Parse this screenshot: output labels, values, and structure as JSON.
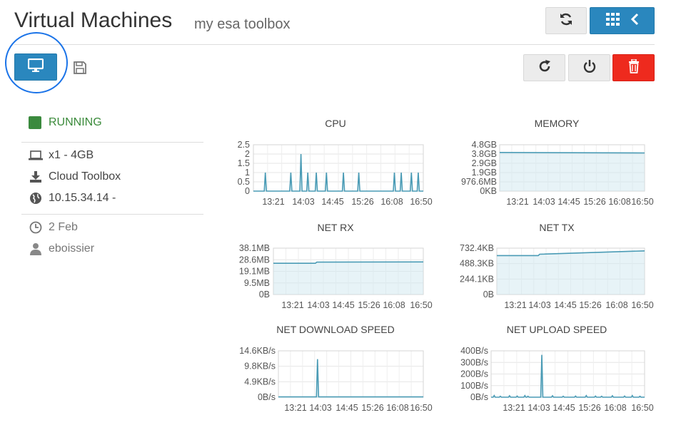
{
  "header": {
    "title": "Virtual Machines",
    "subtitle": "my esa toolbox"
  },
  "icons": {
    "refresh": "refresh-icon",
    "apps": "grid-icon",
    "back": "chevron-left-icon",
    "console": "monitor-icon",
    "snapshot": "floppy-disk-icon",
    "restart": "restart-icon",
    "power": "power-icon",
    "delete": "trash-icon"
  },
  "colors": {
    "accent": "#2a87be",
    "danger": "#ee2a1e",
    "running": "#3b8a3e",
    "line": "#4a9bb5"
  },
  "vm": {
    "status": "RUNNING",
    "specs": "x1 - 4GB",
    "image": "Cloud Toolbox",
    "ip": "10.15.34.14 -",
    "created": "2 Feb",
    "owner": "eboissier"
  },
  "chart_data": [
    {
      "id": "cpu",
      "type": "line",
      "title": "CPU",
      "x": [
        "13:21",
        "14:03",
        "14:45",
        "15:26",
        "16:08",
        "16:50"
      ],
      "y_ticks": [
        "2.5",
        "2",
        "1.5",
        "1",
        "0.5",
        "0"
      ],
      "ylim": [
        0,
        2.5
      ],
      "spikes": [
        [
          0.07,
          1
        ],
        [
          0.22,
          1
        ],
        [
          0.28,
          2
        ],
        [
          0.32,
          1
        ],
        [
          0.37,
          1
        ],
        [
          0.43,
          1
        ],
        [
          0.53,
          1
        ],
        [
          0.62,
          1
        ],
        [
          0.83,
          1
        ],
        [
          0.87,
          1
        ],
        [
          0.93,
          1
        ],
        [
          0.97,
          1
        ]
      ],
      "baseline": 0
    },
    {
      "id": "memory",
      "type": "line",
      "title": "MEMORY",
      "x": [
        "13:21",
        "14:03",
        "14:45",
        "15:26",
        "16:08",
        "16:50"
      ],
      "y_ticks": [
        "4.8GB",
        "3.8GB",
        "2.9GB",
        "1.9GB",
        "976.6MB",
        "0KB"
      ],
      "ylim": [
        0,
        4.8
      ],
      "baseline": 4.0,
      "baseline_end": 3.95
    },
    {
      "id": "net-rx",
      "type": "line",
      "title": "NET RX",
      "x": [
        "13:21",
        "14:03",
        "14:45",
        "15:26",
        "16:08",
        "16:50"
      ],
      "y_ticks": [
        "38.1MB",
        "28.6MB",
        "19.1MB",
        "9.5MB",
        "0B"
      ],
      "ylim": [
        0,
        38.1
      ],
      "baseline": 25.7,
      "step_at": 0.28,
      "baseline_end": 26.8
    },
    {
      "id": "net-tx",
      "type": "line",
      "title": "NET TX",
      "x": [
        "13:21",
        "14:03",
        "14:45",
        "15:26",
        "16:08",
        "16:50"
      ],
      "y_ticks": [
        "732.4KB",
        "488.3KB",
        "244.1KB",
        "0B"
      ],
      "ylim": [
        0,
        732.4
      ],
      "baseline": 615,
      "step_at": 0.28,
      "baseline_end": 690
    },
    {
      "id": "net-download",
      "type": "line",
      "title": "NET DOWNLOAD SPEED",
      "x": [
        "13:21",
        "14:03",
        "14:45",
        "15:26",
        "16:08",
        "16:50"
      ],
      "y_ticks": [
        "14.6KB/s",
        "9.8KB/s",
        "4.9KB/s",
        "0B/s"
      ],
      "ylim": [
        0,
        14.6
      ],
      "spikes": [
        [
          0.27,
          12
        ]
      ],
      "baseline": 0.1
    },
    {
      "id": "net-upload",
      "type": "line",
      "title": "NET UPLOAD SPEED",
      "x": [
        "13:21",
        "14:03",
        "14:45",
        "15:26",
        "16:08",
        "16:50"
      ],
      "y_ticks": [
        "400B/s",
        "300B/s",
        "200B/s",
        "100B/s",
        "0B/s"
      ],
      "ylim": [
        0,
        400
      ],
      "spikes": [
        [
          0.02,
          15
        ],
        [
          0.06,
          8
        ],
        [
          0.12,
          12
        ],
        [
          0.17,
          10
        ],
        [
          0.22,
          14
        ],
        [
          0.24,
          8
        ],
        [
          0.33,
          365
        ],
        [
          0.4,
          12
        ],
        [
          0.47,
          8
        ],
        [
          0.55,
          10
        ],
        [
          0.62,
          14
        ],
        [
          0.68,
          10
        ],
        [
          0.72,
          8
        ],
        [
          0.79,
          12
        ],
        [
          0.87,
          10
        ],
        [
          0.92,
          14
        ],
        [
          0.97,
          8
        ]
      ],
      "baseline": 0
    }
  ]
}
